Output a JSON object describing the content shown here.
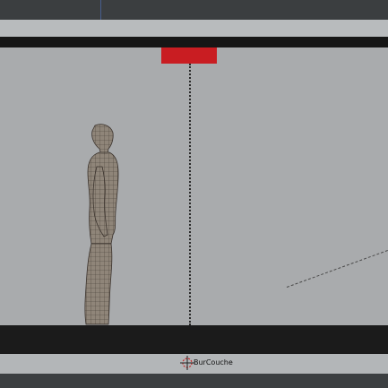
{
  "viewport": {
    "camera_label": "BurCouche",
    "camera_marker_color": "#c91d22",
    "view_background": "#a9abad"
  },
  "icons": {
    "origin": "origin-crosshair-icon",
    "figure": "human-mesh-figure"
  }
}
